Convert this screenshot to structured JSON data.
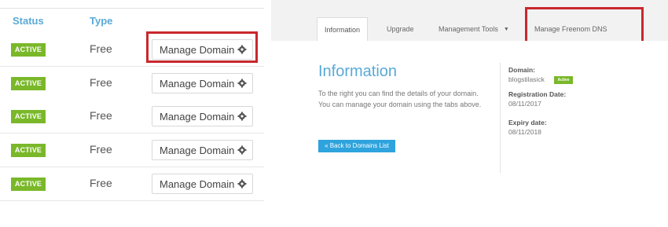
{
  "domains_table": {
    "headers": {
      "status": "Status",
      "type": "Type"
    },
    "rows": [
      {
        "status": "ACTIVE",
        "type": "Free",
        "action": "Manage Domain",
        "highlighted": true
      },
      {
        "status": "ACTIVE",
        "type": "Free",
        "action": "Manage Domain",
        "highlighted": false
      },
      {
        "status": "ACTIVE",
        "type": "Free",
        "action": "Manage Domain",
        "highlighted": false
      },
      {
        "status": "ACTIVE",
        "type": "Free",
        "action": "Manage Domain",
        "highlighted": false
      },
      {
        "status": "ACTIVE",
        "type": "Free",
        "action": "Manage Domain",
        "highlighted": false
      }
    ],
    "action_icon": "gear-icon"
  },
  "domain_detail": {
    "tabs": {
      "information": "Information",
      "upgrade": "Upgrade",
      "management_tools": "Management Tools",
      "manage_dns": "Manage Freenom DNS"
    },
    "dropdown_icon": "caret-down-icon",
    "title": "Information",
    "description_line1": "To the right you can find the details of your domain.",
    "description_line2": "You can manage your domain using the tabs above.",
    "back_button": "« Back to Domains List",
    "domain_label": "Domain:",
    "domain_value": "blogstilasick",
    "domain_status": "Active",
    "registration_label": "Registration Date:",
    "registration_value": "08/11/2017",
    "expiry_label": "Expiry date:",
    "expiry_value": "08/11/2018"
  },
  "colors": {
    "accent_blue": "#5aa9d6",
    "active_green": "#7ab82a",
    "highlight_red": "#c8282d",
    "button_blue": "#2ea3dd"
  }
}
